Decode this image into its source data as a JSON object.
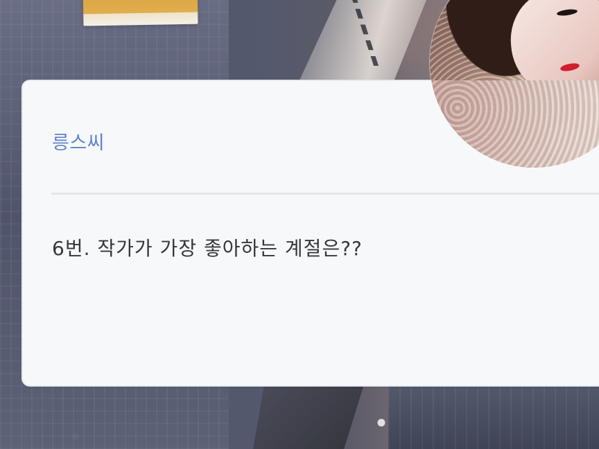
{
  "post": {
    "author": "릉스씨",
    "message": "6번. 작가가 가장 좋아하는 계절은??"
  },
  "icons": {
    "avatar": "profile-photo"
  }
}
